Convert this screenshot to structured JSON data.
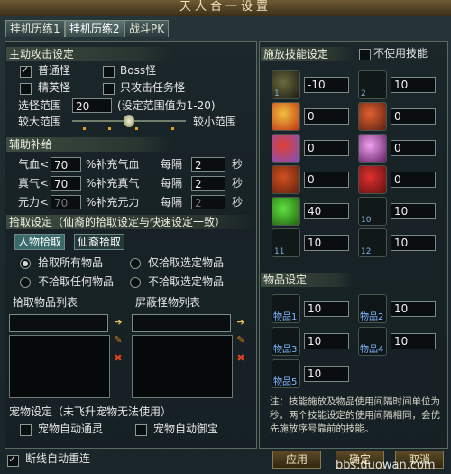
{
  "title": "天人合一设置",
  "tabs": [
    "挂机历练1",
    "挂机历练2",
    "战斗PK"
  ],
  "attack": {
    "header": "主动攻击设定",
    "options": [
      {
        "label": "普通怪",
        "checked": true
      },
      {
        "label": "Boss怪",
        "checked": false
      },
      {
        "label": "精英怪",
        "checked": false
      },
      {
        "label": "只攻击任务怪",
        "checked": false
      }
    ],
    "range_label": "选怪范围",
    "range_value": "20",
    "range_hint": "(设定范围值为1-20)",
    "large_label": "较大范围",
    "small_label": "较小范围",
    "slider_value": 0.5
  },
  "supply": {
    "header": "辅助补给",
    "rows": [
      {
        "label": "气血<",
        "value": "70",
        "suffix": "%补充气血",
        "every": "每隔",
        "interval": "2",
        "unit": "秒",
        "disabled": false
      },
      {
        "label": "真气<",
        "value": "70",
        "suffix": "%补充真气",
        "every": "每隔",
        "interval": "2",
        "unit": "秒",
        "disabled": false
      },
      {
        "label": "元力<",
        "value": "70",
        "suffix": "%补充元力",
        "every": "每隔",
        "interval": "2",
        "unit": "秒",
        "disabled": true
      }
    ]
  },
  "pickup": {
    "header": "拾取设定（仙裔的拾取设定与快速设定一致）",
    "subtabs": [
      "人物拾取",
      "仙裔拾取"
    ],
    "options": [
      {
        "label": "拾取所有物品",
        "selected": true
      },
      {
        "label": "仅拾取选定物品",
        "selected": false
      },
      {
        "label": "不拾取任何物品",
        "selected": false
      },
      {
        "label": "不拾取选定物品",
        "selected": false
      }
    ],
    "list_left_title": "拾取物品列表",
    "list_right_title": "屏蔽怪物列表"
  },
  "pet": {
    "header": "宠物设定（未飞升宠物无法使用）",
    "options": [
      {
        "label": "宠物自动通灵",
        "checked": false
      },
      {
        "label": "宠物自动御宝",
        "checked": false
      }
    ]
  },
  "skills": {
    "header": "施放技能设定",
    "no_skill_label": "不使用技能",
    "no_skill_checked": false,
    "slots": [
      {
        "num": "1",
        "value": "-10",
        "colors": [
          "#6a6a40",
          "#1a1a10"
        ]
      },
      {
        "num": "2",
        "value": "10",
        "colors": [
          "#101818",
          "#101818"
        ]
      },
      {
        "num": "",
        "value": "0",
        "colors": [
          "#f0c040",
          "#c03010"
        ]
      },
      {
        "num": "",
        "value": "0",
        "colors": [
          "#e06030",
          "#5a2010"
        ]
      },
      {
        "num": "",
        "value": "0",
        "colors": [
          "#e04030",
          "#8050c0"
        ]
      },
      {
        "num": "",
        "value": "0",
        "colors": [
          "#f0a0f0",
          "#602060"
        ]
      },
      {
        "num": "",
        "value": "0",
        "colors": [
          "#d05020",
          "#602010"
        ]
      },
      {
        "num": "",
        "value": "0",
        "colors": [
          "#e03030",
          "#601010"
        ]
      },
      {
        "num": "",
        "value": "40",
        "colors": [
          "#60e040",
          "#206010"
        ]
      },
      {
        "num": "10",
        "value": "10",
        "colors": [
          "#101818",
          "#101818"
        ]
      },
      {
        "num": "11",
        "value": "10",
        "colors": [
          "#101818",
          "#101818"
        ]
      },
      {
        "num": "12",
        "value": "10",
        "colors": [
          "#101818",
          "#101818"
        ]
      }
    ]
  },
  "items": {
    "header": "物品设定",
    "slots": [
      {
        "name": "物品1",
        "value": "10"
      },
      {
        "name": "物品2",
        "value": "10"
      },
      {
        "name": "物品3",
        "value": "10"
      },
      {
        "name": "物品4",
        "value": "10"
      },
      {
        "name": "物品5",
        "value": "10"
      }
    ],
    "note": "注：技能施放及物品使用间隔时间单位为秒。两个技能设定的使用间隔相同，会优先施放序号靠前的技能。"
  },
  "footer": {
    "reconnect_label": "断线自动重连",
    "reconnect_checked": true,
    "apply": "应用",
    "confirm": "确定",
    "cancel": "取消",
    "watermark": "bbs.duowan.com"
  }
}
